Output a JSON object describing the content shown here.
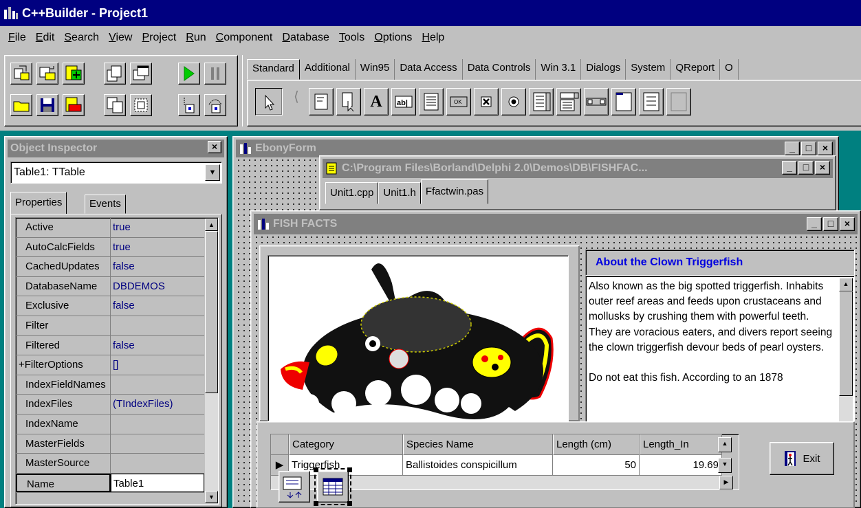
{
  "app": {
    "title": "C++Builder - Project1"
  },
  "menu": [
    {
      "label": "File",
      "key": "F"
    },
    {
      "label": "Edit",
      "key": "E"
    },
    {
      "label": "Search",
      "key": "S"
    },
    {
      "label": "View",
      "key": "V"
    },
    {
      "label": "Project",
      "key": "P"
    },
    {
      "label": "Run",
      "key": "R"
    },
    {
      "label": "Component",
      "key": "C"
    },
    {
      "label": "Database",
      "key": "D"
    },
    {
      "label": "Tools",
      "key": "T"
    },
    {
      "label": "Options",
      "key": "O"
    },
    {
      "label": "Help",
      "key": "H"
    }
  ],
  "palette_tabs": [
    "Standard",
    "Additional",
    "Win95",
    "Data Access",
    "Data Controls",
    "Win 3.1",
    "Dialogs",
    "System",
    "QReport",
    "O"
  ],
  "object_inspector": {
    "title": "Object Inspector",
    "selected_object": "Table1: TTable",
    "tabs": {
      "properties": "Properties",
      "events": "Events"
    },
    "properties": [
      {
        "name": "Active",
        "value": "true"
      },
      {
        "name": "AutoCalcFields",
        "value": "true"
      },
      {
        "name": "CachedUpdates",
        "value": "false"
      },
      {
        "name": "DatabaseName",
        "value": "DBDEMOS"
      },
      {
        "name": "Exclusive",
        "value": "false"
      },
      {
        "name": "Filter",
        "value": ""
      },
      {
        "name": "Filtered",
        "value": "false"
      },
      {
        "name": "+FilterOptions",
        "value": "[]"
      },
      {
        "name": "IndexFieldNames",
        "value": ""
      },
      {
        "name": "IndexFiles",
        "value": "(TIndexFiles)"
      },
      {
        "name": "IndexName",
        "value": ""
      },
      {
        "name": "MasterFields",
        "value": ""
      },
      {
        "name": "MasterSource",
        "value": ""
      },
      {
        "name": "Name",
        "value": "Table1"
      }
    ]
  },
  "ebony_form": {
    "title": "EbonyForm"
  },
  "editor": {
    "title": "C:\\Program Files\\Borland\\Delphi 2.0\\Demos\\DB\\FISHFAC...",
    "tabs": [
      "Unit1.cpp",
      "Unit1.h",
      "Ffactwin.pas"
    ]
  },
  "fish_facts": {
    "title": "FISH FACTS",
    "about_heading": "About the Clown Triggerfish",
    "about_paragraph1": "Also known as the big spotted triggerfish. Inhabits outer reef areas and feeds upon crustaceans and mollusks by crushing them with powerful teeth.  They are voracious eaters, and divers report seeing the clown triggerfish devour beds of pearl oysters.",
    "about_paragraph2": "Do not eat this fish.  According to an 1878",
    "grid": {
      "columns": [
        "Category",
        "Species Name",
        "Length (cm)",
        "Length_In"
      ],
      "row": [
        "Triggerfish",
        "Ballistoides conspicillum",
        "50",
        "19.69"
      ]
    },
    "exit_label": "Exit"
  },
  "colors": {
    "title_active": "#000080",
    "title_inactive": "#808080",
    "face": "#c0c0c0",
    "desktop": "#008080",
    "value_blue": "#000080"
  }
}
